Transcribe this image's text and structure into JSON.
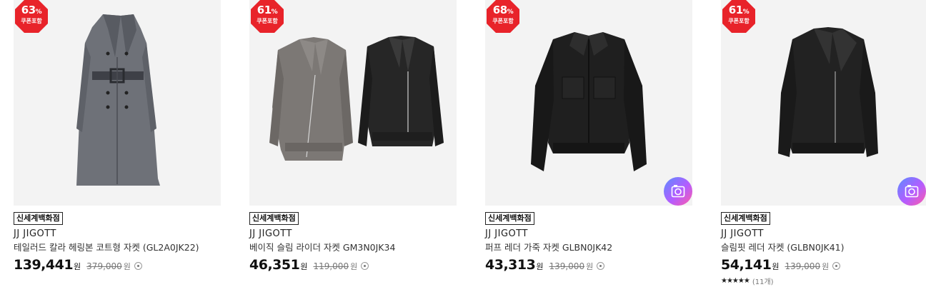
{
  "badge_color": "#e8232a",
  "products": [
    {
      "discount": "63",
      "pct_sign": "%",
      "coupon": "쿠폰포함",
      "store": "신세계백화점",
      "brand": "JJ JIGOTT",
      "title": "테일러드 칼라 헤링본 코트형 자켓 (GL2A0JK22)",
      "price": "139,441",
      "currency": "원",
      "original_price": "379,000",
      "image_icon": "none"
    },
    {
      "discount": "61",
      "pct_sign": "%",
      "coupon": "쿠폰포함",
      "store": "신세계백화점",
      "brand": "JJ JIGOTT",
      "title": "베이직 슬림 라이더 자켓 GM3N0JK34",
      "price": "46,351",
      "currency": "원",
      "original_price": "119,000",
      "image_icon": "none"
    },
    {
      "discount": "68",
      "pct_sign": "%",
      "coupon": "쿠폰포함",
      "store": "신세계백화점",
      "brand": "JJ JIGOTT",
      "title": "퍼프 레더 가죽 자켓 GLBN0JK42",
      "price": "43,313",
      "currency": "원",
      "original_price": "139,000",
      "image_icon": "camera-icon"
    },
    {
      "discount": "61",
      "pct_sign": "%",
      "coupon": "쿠폰포함",
      "store": "신세계백화점",
      "brand": "JJ JIGOTT",
      "title": "슬림핏 레더 자켓 (GLBN0JK41)",
      "price": "54,141",
      "currency": "원",
      "original_price": "139,000",
      "image_icon": "camera-icon",
      "rating_stars": 5,
      "stars_text": "★★★★★",
      "review_count": "(11개)"
    }
  ]
}
